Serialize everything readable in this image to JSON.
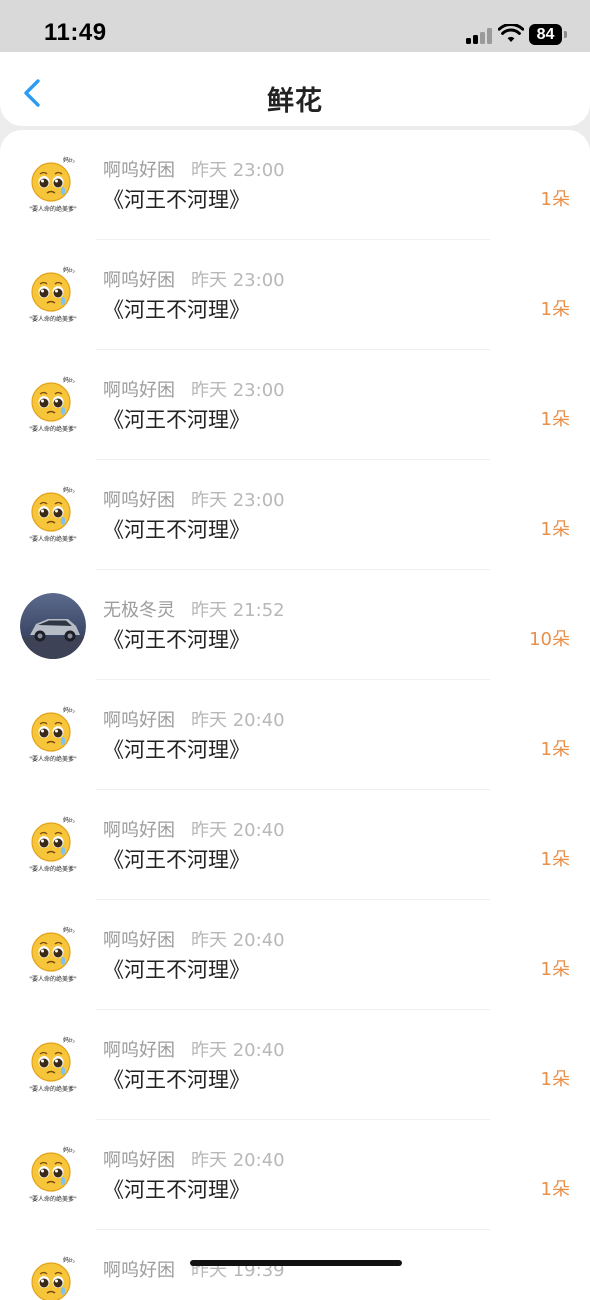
{
  "status_bar": {
    "time": "11:49",
    "battery": "84"
  },
  "header": {
    "title": "鲜花",
    "back_icon": "chevron-left-icon"
  },
  "colors": {
    "accent": "#2b9bf4",
    "count": "#e8904a"
  },
  "items": [
    {
      "username": "啊呜好困",
      "time": "昨天 23:00",
      "title": "《河王不河理》",
      "count": "1朵",
      "avatar": "crying-emoji"
    },
    {
      "username": "啊呜好困",
      "time": "昨天 23:00",
      "title": "《河王不河理》",
      "count": "1朵",
      "avatar": "crying-emoji"
    },
    {
      "username": "啊呜好困",
      "time": "昨天 23:00",
      "title": "《河王不河理》",
      "count": "1朵",
      "avatar": "crying-emoji"
    },
    {
      "username": "啊呜好困",
      "time": "昨天 23:00",
      "title": "《河王不河理》",
      "count": "1朵",
      "avatar": "crying-emoji"
    },
    {
      "username": "无极冬灵",
      "time": "昨天 21:52",
      "title": "《河王不河理》",
      "count": "10朵",
      "avatar": "car-photo"
    },
    {
      "username": "啊呜好困",
      "time": "昨天 20:40",
      "title": "《河王不河理》",
      "count": "1朵",
      "avatar": "crying-emoji"
    },
    {
      "username": "啊呜好困",
      "time": "昨天 20:40",
      "title": "《河王不河理》",
      "count": "1朵",
      "avatar": "crying-emoji"
    },
    {
      "username": "啊呜好困",
      "time": "昨天 20:40",
      "title": "《河王不河理》",
      "count": "1朵",
      "avatar": "crying-emoji"
    },
    {
      "username": "啊呜好困",
      "time": "昨天 20:40",
      "title": "《河王不河理》",
      "count": "1朵",
      "avatar": "crying-emoji"
    },
    {
      "username": "啊呜好困",
      "time": "昨天 20:40",
      "title": "《河王不河理》",
      "count": "1朵",
      "avatar": "crying-emoji"
    },
    {
      "username": "啊呜好困",
      "time": "昨天 19:39",
      "title": "",
      "count": "",
      "avatar": "crying-emoji"
    }
  ]
}
